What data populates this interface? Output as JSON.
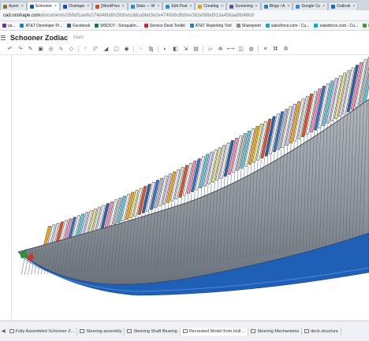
{
  "browser": {
    "tabs": [
      {
        "label": "Ayem",
        "color": "#8b6e3d",
        "active": false
      },
      {
        "label": "Schooner",
        "color": "#1c4fa3",
        "active": true
      },
      {
        "label": "Onshape",
        "color": "#1c4fa3",
        "active": false
      },
      {
        "label": "[WordPres",
        "color": "#d04a2c",
        "active": false
      },
      {
        "label": "Stats — W",
        "color": "#3a87b8",
        "active": false
      },
      {
        "label": "Edit Post",
        "color": "#3a87b8",
        "active": false
      },
      {
        "label": "Creating",
        "color": "#d9a21b",
        "active": false
      },
      {
        "label": "Screening",
        "color": "#6a4c9c",
        "active": false
      },
      {
        "label": "Blogs / A",
        "color": "#2f7db8",
        "active": false
      },
      {
        "label": "Google Co",
        "color": "#3f7fe0",
        "active": false
      },
      {
        "label": "Outlook",
        "color": "#2462b3",
        "active": false
      }
    ],
    "url_host": "cad.onshape.com",
    "url_path": "/documents/269df1ae9c074d46bd0c5fd/w/cddcabbd3e2e4740d6c8b9/e/382e58bd913a458aa9fd46b9",
    "bookmarks": [
      {
        "label": "ya...",
        "color": "#6b2fa8"
      },
      {
        "label": "AT&T Developer Pr...",
        "color": "#1a82c4"
      },
      {
        "label": "Facebook",
        "color": "#3b5998"
      },
      {
        "label": "WSDOT - Snoqualm...",
        "color": "#1e7b3c"
      },
      {
        "label": "Service Desk Toolkit",
        "color": "#d0232a"
      },
      {
        "label": "AT&T Reporting Tool",
        "color": "#1a82c4"
      },
      {
        "label": "Sharepoint",
        "color": "#888888"
      },
      {
        "label": "salesforce.com - Cu...",
        "color": "#1ba1e2"
      },
      {
        "label": "salesforce.com - Cu...",
        "color": "#1ba1e2"
      },
      {
        "label": "Map - sh",
        "color": "#3c9a3c"
      }
    ]
  },
  "app": {
    "document_title": "Schooner Zodiac",
    "workspace": "Main",
    "toolbar_icons": [
      "undo-icon",
      "redo-icon",
      "sketch-icon",
      "extrude-icon",
      "revolve-icon",
      "sweep-icon",
      "loft-icon",
      "sep",
      "fillet-icon",
      "chamfer-icon",
      "draft-icon",
      "shell-icon",
      "hole-icon",
      "sep",
      "pattern-icon",
      "mirror-icon",
      "sep",
      "boolean-icon",
      "split-icon",
      "transform-icon",
      "delete-part-icon",
      "sep",
      "plane-icon",
      "mate-connector-icon",
      "measure-icon",
      "section-icon",
      "appearance-icon",
      "sep",
      "variable-icon",
      "feature-script-icon",
      "settings-icon"
    ]
  },
  "bottom_tabs": [
    {
      "label": "Fully Assembled Schooner Z...",
      "active": false
    },
    {
      "label": "Steering assembly",
      "active": false
    },
    {
      "label": "Steering Shaft Bearing",
      "active": false
    },
    {
      "label": "Recreated Model from Hull ...",
      "active": true
    },
    {
      "label": "Steering Mechanisms",
      "active": false
    },
    {
      "label": "deck structure",
      "active": false
    }
  ],
  "colors": {
    "hull": "#8f969f",
    "hull_dark": "#5c636c",
    "keel_blue": "#1f5fb5",
    "frame_palette": [
      "#f2a81a",
      "#e0522c",
      "#3a6fc4",
      "#cfc8e6",
      "#d8d8d8",
      "#f08fb4",
      "#5ec7d8",
      "#e8e080",
      "#2e5fa8",
      "#b9b9c0"
    ]
  }
}
